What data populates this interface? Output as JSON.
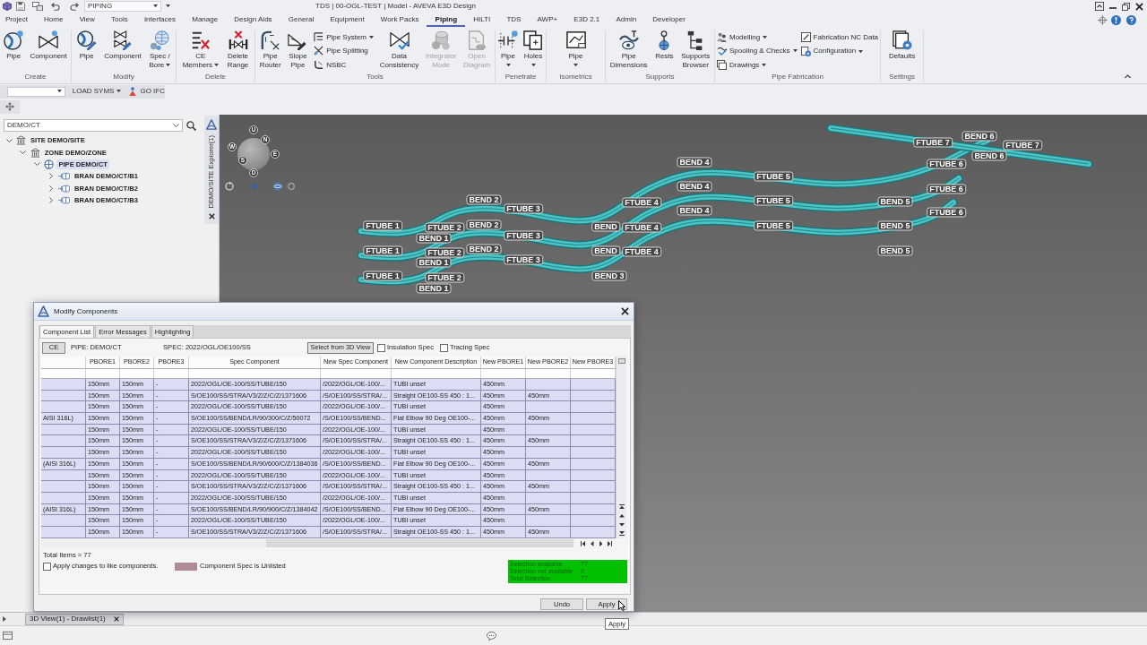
{
  "title_bar": {
    "module": "PIPING",
    "title": "TDS | 00-OGL-TEST | Model - AVEVA E3D Design"
  },
  "menu_tabs": [
    {
      "label": "Project",
      "selected": false
    },
    {
      "label": "Home",
      "selected": false
    },
    {
      "label": "View",
      "selected": false
    },
    {
      "label": "Tools",
      "selected": false
    },
    {
      "label": "Interfaces",
      "selected": false
    },
    {
      "label": "Manage",
      "selected": false
    },
    {
      "label": "Design Aids",
      "selected": false
    },
    {
      "label": "General",
      "selected": false
    },
    {
      "label": "Equipment",
      "selected": false
    },
    {
      "label": "Work Packs",
      "selected": false
    },
    {
      "label": "Piping",
      "selected": true
    },
    {
      "label": "HILTI",
      "selected": false
    },
    {
      "label": "TDS",
      "selected": false
    },
    {
      "label": "AWP+",
      "selected": false
    },
    {
      "label": "E3D 2.1",
      "selected": false
    },
    {
      "label": "Admin",
      "selected": false
    },
    {
      "label": "Developer",
      "selected": false
    }
  ],
  "ribbon_groups": [
    {
      "label": "Create",
      "items": [
        {
          "kind": "large",
          "lines": [
            "Pipe"
          ],
          "dropdown": false,
          "disabled": false
        },
        {
          "kind": "large",
          "lines": [
            "Component"
          ],
          "dropdown": false,
          "disabled": false
        }
      ]
    },
    {
      "label": "Modify",
      "items": [
        {
          "kind": "large",
          "lines": [
            "Pipe"
          ],
          "dropdown": false,
          "disabled": false
        },
        {
          "kind": "large",
          "lines": [
            "Component"
          ],
          "dropdown": false,
          "disabled": false
        },
        {
          "kind": "large",
          "lines": [
            "Spec /",
            "Bore"
          ],
          "dropdown": true,
          "disabled": false
        }
      ]
    },
    {
      "label": "Delete",
      "items": [
        {
          "kind": "large",
          "lines": [
            "CE",
            "Members"
          ],
          "dropdown": true,
          "disabled": false
        },
        {
          "kind": "large",
          "lines": [
            "Delete",
            "Range"
          ],
          "dropdown": false,
          "disabled": false
        }
      ]
    },
    {
      "label": "Tools",
      "items": [
        {
          "kind": "large",
          "lines": [
            "Pipe",
            "Router"
          ],
          "dropdown": false,
          "disabled": false
        },
        {
          "kind": "large",
          "lines": [
            "Slope",
            "Pipe"
          ],
          "dropdown": false,
          "disabled": false
        },
        {
          "kind": "stack",
          "items": [
            {
              "label": "Pipe System",
              "dropdown": true,
              "disabled": false
            },
            {
              "label": "Pipe Splitting",
              "dropdown": false,
              "disabled": false
            },
            {
              "label": "NSBC",
              "dropdown": false,
              "disabled": false
            }
          ]
        },
        {
          "kind": "large",
          "lines": [
            "Data",
            "Consistency"
          ],
          "dropdown": false,
          "disabled": false
        },
        {
          "kind": "large",
          "lines": [
            "Integrator",
            "Mode"
          ],
          "dropdown": false,
          "disabled": true
        },
        {
          "kind": "large",
          "lines": [
            "Open",
            "Diagram"
          ],
          "dropdown": false,
          "disabled": true
        }
      ]
    },
    {
      "label": "Penetrate",
      "items": [
        {
          "kind": "large",
          "lines": [
            "Pipe"
          ],
          "dropdown": true,
          "disabled": false
        },
        {
          "kind": "large",
          "lines": [
            "Holes"
          ],
          "dropdown": true,
          "disabled": false
        }
      ]
    },
    {
      "label": "Isometrics",
      "items": [
        {
          "kind": "large",
          "lines": [
            "Pipe"
          ],
          "dropdown": true,
          "disabled": false
        }
      ]
    },
    {
      "label": "Supports",
      "items": [
        {
          "kind": "large",
          "lines": [
            "Pipe",
            "Dimensions"
          ],
          "dropdown": false,
          "disabled": false
        },
        {
          "kind": "large",
          "lines": [
            "Rests"
          ],
          "dropdown": false,
          "disabled": false
        },
        {
          "kind": "large",
          "lines": [
            "Supports",
            "Browser"
          ],
          "dropdown": false,
          "disabled": false
        }
      ]
    },
    {
      "label": "Pipe Fabrication",
      "items": [
        {
          "kind": "stack",
          "items": [
            {
              "label": "Modelling",
              "dropdown": true,
              "disabled": false
            },
            {
              "label": "Spooling & Checks",
              "dropdown": true,
              "disabled": false
            },
            {
              "label": "Drawings",
              "dropdown": true,
              "disabled": false
            }
          ]
        },
        {
          "kind": "stack",
          "items": [
            {
              "label": "Fabrication NC Data",
              "dropdown": false,
              "disabled": false
            },
            {
              "label": "Configuration",
              "dropdown": true,
              "disabled": false
            }
          ]
        }
      ]
    },
    {
      "label": "Settings",
      "items": [
        {
          "kind": "large",
          "lines": [
            "Defaults"
          ],
          "dropdown": false,
          "disabled": false
        }
      ]
    }
  ],
  "toolbar": {
    "items": [
      {
        "kind": "combo"
      },
      {
        "kind": "menu",
        "label": "LOAD SYMS"
      },
      {
        "kind": "button",
        "label": "GO IFC"
      }
    ]
  },
  "explorer": {
    "search": "DEMO/CT",
    "panel_title": "DEMO/SITE Explorer(1)",
    "tree": [
      {
        "kind": "site",
        "label": "SITE DEMO/SITE",
        "expanded": true,
        "selected": false,
        "children": [
          {
            "kind": "zone",
            "label": "ZONE DEMO/ZONE",
            "expanded": true,
            "selected": false,
            "children": [
              {
                "kind": "pipe",
                "label": "PIPE DEMO/CT",
                "expanded": true,
                "selected": true,
                "children": [
                  {
                    "kind": "bran",
                    "label": "BRAN DEMO/CT/B1",
                    "expanded": false,
                    "selected": false
                  },
                  {
                    "kind": "bran",
                    "label": "BRAN DEMO/CT/B2",
                    "expanded": false,
                    "selected": false
                  },
                  {
                    "kind": "bran",
                    "label": "BRAN DEMO/CT/B3",
                    "expanded": false,
                    "selected": false
                  }
                ]
              }
            ]
          }
        ]
      }
    ]
  },
  "view_3d": {
    "compass": [
      "U",
      "N",
      "W",
      "E",
      "S",
      "D"
    ],
    "labels": [
      "BEND 6",
      "FTUBE 7",
      "FTUBE 7",
      "BEND 6",
      "BEND 4",
      "FTUBE 6",
      "FTUBE 5",
      "BEND 4",
      "FTUBE 6",
      "BEND 2",
      "FTUBE 4",
      "FTUBE 5",
      "BEND 5",
      "FTUBE 3",
      "BEND 4",
      "FTUBE 6",
      "FTUBE 1",
      "FTUBE 2",
      "BEND 2",
      "BEND",
      "FTUBE 4",
      "FTUBE 5",
      "BEND 5",
      "BEND 1",
      "FTUBE 3",
      "FTUBE 1",
      "FTUBE 2",
      "BEND 2",
      "BEND",
      "FTUBE 4",
      "BEND 5",
      "BEND 1",
      "FTUBE 3",
      "FTUBE 1",
      "FTUBE 2",
      "BEND 3",
      "BEND 1"
    ]
  },
  "dialog": {
    "title": "Modify Components",
    "tabs": [
      {
        "label": "Component List",
        "selected": true
      },
      {
        "label": "Error Messages",
        "selected": false
      },
      {
        "label": "Highlighting",
        "selected": false
      }
    ],
    "ce_button": "CE",
    "pipe": "PIPE: DEMO/CT",
    "spec": "SPEC: 2022/OGL/OE100/SS",
    "select_button": "Select from 3D View",
    "options": [
      {
        "label": "Insulation Spec",
        "checked": false
      },
      {
        "label": "Tracing Spec",
        "checked": false
      }
    ],
    "table": {
      "columns": [
        "PBORE1",
        "PBORE2",
        "PBORE3",
        "Spec Component",
        "New Spec Component",
        "New Component Description",
        "New PBORE1",
        "New PBORE2",
        "New PBORE3"
      ],
      "rows": [
        {
          "selected": true,
          "cells": [
            "150mm",
            "150mm",
            "-",
            "2022/OGL/OE-100/SS/TUBE/150",
            "/2022/OGL/OE-100/...",
            "TUBI unset",
            "450mm"
          ]
        },
        {
          "selected": true,
          "cells": [
            "150mm",
            "150mm",
            "-",
            "S/OE100/SS/STRA/V3/Z/Z/C/Z/1371606",
            "/S/OE100/SS/STRA/...",
            "Straight OE100-SS 450 : 1...",
            "450mm",
            "450mm"
          ]
        },
        {
          "selected": true,
          "cells": [
            "150mm",
            "150mm",
            "-",
            "2022/OGL/OE-100/SS/TUBE/150",
            "/2022/OGL/OE-100/...",
            "TUBI unset",
            "450mm"
          ]
        },
        {
          "selected": true,
          "column_1": "AISI 316L)",
          "cells": [
            "150mm",
            "150mm",
            "-",
            "S/OE100/SS/BEND/LR/90/300/C/Z/50072",
            "/S/OE100/SS/BEND...",
            "Flat Elbow 90 Deg OE100-...",
            "450mm",
            "450mm"
          ]
        },
        {
          "selected": true,
          "cells": [
            "150mm",
            "150mm",
            "-",
            "2022/OGL/OE-100/SS/TUBE/150",
            "/2022/OGL/OE-100/...",
            "TUBI unset",
            "450mm"
          ]
        },
        {
          "selected": true,
          "cells": [
            "150mm",
            "150mm",
            "-",
            "S/OE100/SS/STRA/V3/Z/Z/C/Z/1371606",
            "/S/OE100/SS/STRA/...",
            "Straight OE100-SS 450 : 1...",
            "450mm",
            "450mm"
          ]
        },
        {
          "selected": true,
          "cells": [
            "150mm",
            "150mm",
            "-",
            "2022/OGL/OE-100/SS/TUBE/150",
            "/2022/OGL/OE-100/...",
            "TUBI unset",
            "450mm"
          ]
        },
        {
          "selected": true,
          "column_1": "(AISI 316L)",
          "cells": [
            "150mm",
            "150mm",
            "-",
            "S/OE100/SS/BEND/LR/90/600/C/Z/1384036",
            "/S/OE100/SS/BEND...",
            "Flat Elbow 90 Deg OE100-...",
            "450mm",
            "450mm"
          ]
        },
        {
          "selected": true,
          "cells": [
            "150mm",
            "150mm",
            "-",
            "2022/OGL/OE-100/SS/TUBE/150",
            "/2022/OGL/OE-100/...",
            "TUBI unset",
            "450mm"
          ]
        },
        {
          "selected": true,
          "cells": [
            "150mm",
            "150mm",
            "-",
            "S/OE100/SS/STRA/V3/Z/Z/C/Z/1371606",
            "/S/OE100/SS/STRA/...",
            "Straight OE100-SS 450 : 1...",
            "450mm",
            "450mm"
          ]
        },
        {
          "selected": true,
          "cells": [
            "150mm",
            "150mm",
            "-",
            "2022/OGL/OE-100/SS/TUBE/150",
            "/2022/OGL/OE-100/...",
            "TUBI unset",
            "450mm"
          ]
        },
        {
          "selected": true,
          "column_1": "(AISI 316L)",
          "cells": [
            "150mm",
            "150mm",
            "-",
            "S/OE100/SS/BEND/LR/90/900/C/Z/1384042",
            "/S/OE100/SS/BEND...",
            "Flat Elbow 90 Deg OE100-...",
            "450mm",
            "450mm"
          ]
        },
        {
          "selected": true,
          "cells": [
            "150mm",
            "150mm",
            "-",
            "2022/OGL/OE-100/SS/TUBE/150",
            "/2022/OGL/OE-100/...",
            "TUBI unset",
            "450mm"
          ]
        },
        {
          "selected": true,
          "cells": [
            "150mm",
            "150mm",
            "-",
            "S/OE100/SS/STRA/V3/Z/Z/C/Z/1371606",
            "/S/OE100/SS/STRA/...",
            "Straight OE100-SS 450 : 1...",
            "450mm",
            "450mm"
          ]
        }
      ]
    },
    "total": "Total Items = 77",
    "apply_like": {
      "label": "Apply changes to like components.",
      "checked": false
    },
    "legend": {
      "label": "Component Spec is Unlisted",
      "color": "#b08a98"
    },
    "selection_summary": [
      {
        "label": "Selection available",
        "value": "77"
      },
      {
        "label": "Selection not available",
        "value": "0"
      },
      {
        "label": "Total Selection",
        "value": "77"
      }
    ],
    "buttons": [
      "Undo",
      "Apply"
    ]
  },
  "doc_tabs": [
    {
      "label": "3D View(1) - Drawlist(1)",
      "selected": true
    }
  ],
  "tooltip": "Apply"
}
